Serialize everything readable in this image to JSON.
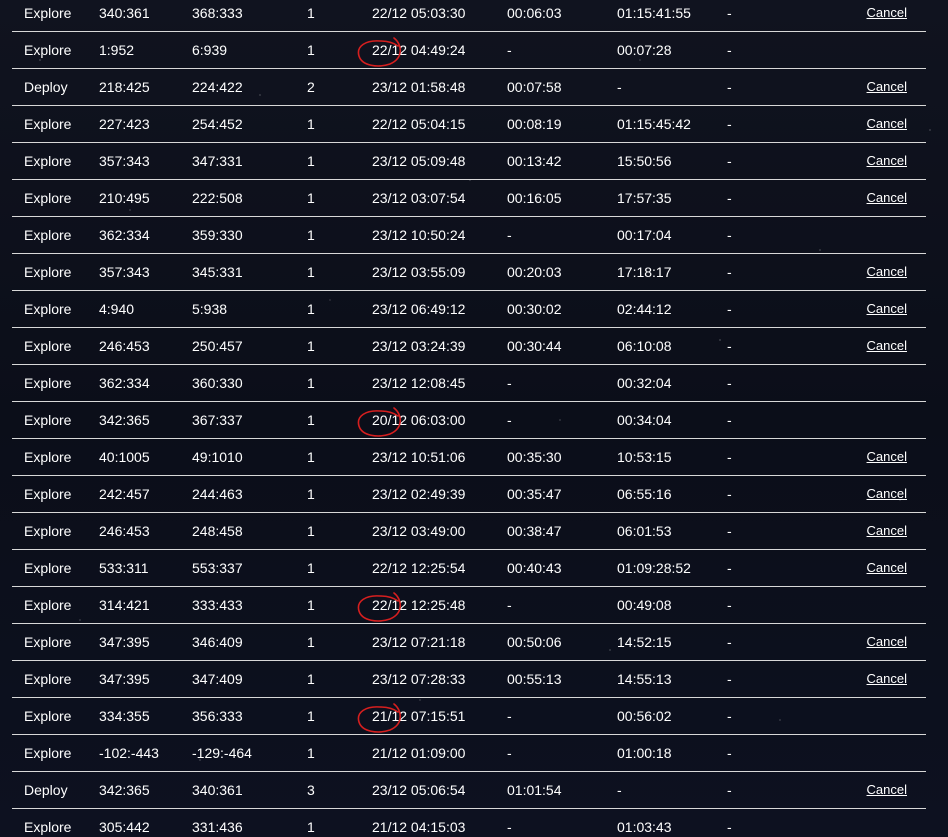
{
  "table": {
    "rows": [
      {
        "type": "Explore",
        "from": "340:361",
        "to": "368:333",
        "units": "1",
        "date": "22/12 05:03:30",
        "time_left": "00:06:03",
        "total": "01:15:41:55",
        "extra": "-",
        "cancel": "Cancel",
        "circled": false
      },
      {
        "type": "Explore",
        "from": "1:952",
        "to": "6:939",
        "units": "1",
        "date": "22/12 04:49:24",
        "time_left": "-",
        "total": "00:07:28",
        "extra": "-",
        "cancel": "",
        "circled": true
      },
      {
        "type": "Deploy",
        "from": "218:425",
        "to": "224:422",
        "units": "2",
        "date": "23/12 01:58:48",
        "time_left": "00:07:58",
        "total": "-",
        "extra": "-",
        "cancel": "Cancel",
        "circled": false
      },
      {
        "type": "Explore",
        "from": "227:423",
        "to": "254:452",
        "units": "1",
        "date": "22/12 05:04:15",
        "time_left": "00:08:19",
        "total": "01:15:45:42",
        "extra": "-",
        "cancel": "Cancel",
        "circled": false
      },
      {
        "type": "Explore",
        "from": "357:343",
        "to": "347:331",
        "units": "1",
        "date": "23/12 05:09:48",
        "time_left": "00:13:42",
        "total": "15:50:56",
        "extra": "-",
        "cancel": "Cancel",
        "circled": false
      },
      {
        "type": "Explore",
        "from": "210:495",
        "to": "222:508",
        "units": "1",
        "date": "23/12 03:07:54",
        "time_left": "00:16:05",
        "total": "17:57:35",
        "extra": "-",
        "cancel": "Cancel",
        "circled": false
      },
      {
        "type": "Explore",
        "from": "362:334",
        "to": "359:330",
        "units": "1",
        "date": "23/12 10:50:24",
        "time_left": "-",
        "total": "00:17:04",
        "extra": "-",
        "cancel": "",
        "circled": false
      },
      {
        "type": "Explore",
        "from": "357:343",
        "to": "345:331",
        "units": "1",
        "date": "23/12 03:55:09",
        "time_left": "00:20:03",
        "total": "17:18:17",
        "extra": "-",
        "cancel": "Cancel",
        "circled": false
      },
      {
        "type": "Explore",
        "from": "4:940",
        "to": "5:938",
        "units": "1",
        "date": "23/12 06:49:12",
        "time_left": "00:30:02",
        "total": "02:44:12",
        "extra": "-",
        "cancel": "Cancel",
        "circled": false
      },
      {
        "type": "Explore",
        "from": "246:453",
        "to": "250:457",
        "units": "1",
        "date": "23/12 03:24:39",
        "time_left": "00:30:44",
        "total": "06:10:08",
        "extra": "-",
        "cancel": "Cancel",
        "circled": false
      },
      {
        "type": "Explore",
        "from": "362:334",
        "to": "360:330",
        "units": "1",
        "date": "23/12 12:08:45",
        "time_left": "-",
        "total": "00:32:04",
        "extra": "-",
        "cancel": "",
        "circled": false
      },
      {
        "type": "Explore",
        "from": "342:365",
        "to": "367:337",
        "units": "1",
        "date": "20/12 06:03:00",
        "time_left": "-",
        "total": "00:34:04",
        "extra": "-",
        "cancel": "",
        "circled": true
      },
      {
        "type": "Explore",
        "from": "40:1005",
        "to": "49:1010",
        "units": "1",
        "date": "23/12 10:51:06",
        "time_left": "00:35:30",
        "total": "10:53:15",
        "extra": "-",
        "cancel": "Cancel",
        "circled": false
      },
      {
        "type": "Explore",
        "from": "242:457",
        "to": "244:463",
        "units": "1",
        "date": "23/12 02:49:39",
        "time_left": "00:35:47",
        "total": "06:55:16",
        "extra": "-",
        "cancel": "Cancel",
        "circled": false
      },
      {
        "type": "Explore",
        "from": "246:453",
        "to": "248:458",
        "units": "1",
        "date": "23/12 03:49:00",
        "time_left": "00:38:47",
        "total": "06:01:53",
        "extra": "-",
        "cancel": "Cancel",
        "circled": false
      },
      {
        "type": "Explore",
        "from": "533:311",
        "to": "553:337",
        "units": "1",
        "date": "22/12 12:25:54",
        "time_left": "00:40:43",
        "total": "01:09:28:52",
        "extra": "-",
        "cancel": "Cancel",
        "circled": false
      },
      {
        "type": "Explore",
        "from": "314:421",
        "to": "333:433",
        "units": "1",
        "date": "22/12 12:25:48",
        "time_left": "-",
        "total": "00:49:08",
        "extra": "-",
        "cancel": "",
        "circled": true
      },
      {
        "type": "Explore",
        "from": "347:395",
        "to": "346:409",
        "units": "1",
        "date": "23/12 07:21:18",
        "time_left": "00:50:06",
        "total": "14:52:15",
        "extra": "-",
        "cancel": "Cancel",
        "circled": false
      },
      {
        "type": "Explore",
        "from": "347:395",
        "to": "347:409",
        "units": "1",
        "date": "23/12 07:28:33",
        "time_left": "00:55:13",
        "total": "14:55:13",
        "extra": "-",
        "cancel": "Cancel",
        "circled": false
      },
      {
        "type": "Explore",
        "from": "334:355",
        "to": "356:333",
        "units": "1",
        "date": "21/12 07:15:51",
        "time_left": "-",
        "total": "00:56:02",
        "extra": "-",
        "cancel": "",
        "circled": true
      },
      {
        "type": "Explore",
        "from": "-102:-443",
        "to": "-129:-464",
        "units": "1",
        "date": "21/12 01:09:00",
        "time_left": "-",
        "total": "01:00:18",
        "extra": "-",
        "cancel": "",
        "circled": false
      },
      {
        "type": "Deploy",
        "from": "342:365",
        "to": "340:361",
        "units": "3",
        "date": "23/12 05:06:54",
        "time_left": "01:01:54",
        "total": "-",
        "extra": "-",
        "cancel": "Cancel",
        "circled": false
      },
      {
        "type": "Explore",
        "from": "305:442",
        "to": "331:436",
        "units": "1",
        "date": "21/12 04:15:03",
        "time_left": "-",
        "total": "01:03:43",
        "extra": "-",
        "cancel": "",
        "circled": false
      }
    ]
  },
  "colors": {
    "background": "#0c0f1b",
    "text": "#ffffff",
    "row_divider": "#d8d8d8",
    "annotation": "#d61f1f"
  }
}
